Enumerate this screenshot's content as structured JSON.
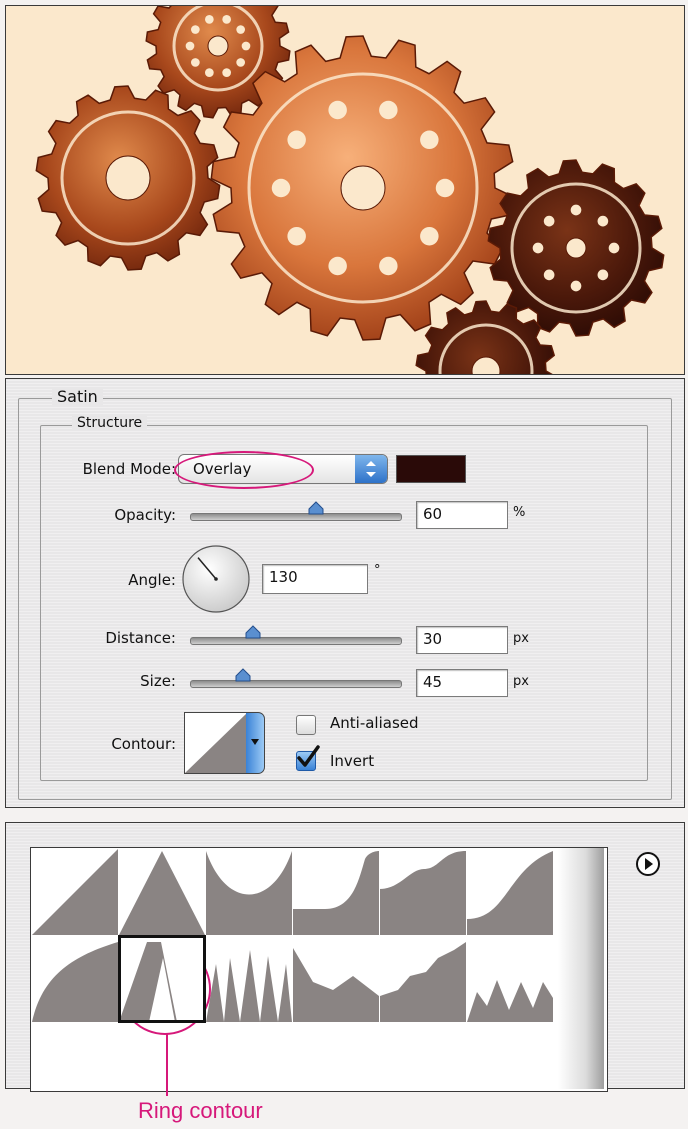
{
  "satin": {
    "title": "Satin",
    "structure_title": "Structure",
    "blend_mode": {
      "label": "Blend Mode:",
      "value": "Overlay",
      "swatch_color": "#2a0a08"
    },
    "opacity": {
      "label": "Opacity:",
      "value": "60",
      "unit": "%",
      "level": 0.6
    },
    "angle": {
      "label": "Angle:",
      "value": "130",
      "unit": "°"
    },
    "distance": {
      "label": "Distance:",
      "value": "30",
      "unit": "px",
      "level": 0.3
    },
    "size": {
      "label": "Size:",
      "value": "45",
      "unit": "px",
      "level": 0.25
    },
    "contour": {
      "label": "Contour:"
    },
    "anti_aliased": {
      "label": "Anti-aliased",
      "checked": false
    },
    "invert": {
      "label": "Invert",
      "checked": true
    }
  },
  "contour_picker": {
    "presets": [
      "linear",
      "cone",
      "cone-inverted",
      "gaussian",
      "half-round",
      "rolling-slope",
      "rounded-steps",
      "ring",
      "ring-double",
      "cove-deep",
      "cove-shallow",
      "sawtooth"
    ],
    "selected_index": 7
  },
  "annotation": {
    "caption": "Ring contour",
    "color": "#d6187a"
  },
  "colors": {
    "highlight": "#d6187a",
    "contour_fill": "#8a8483",
    "slider_thumb": "#5a8fd0"
  }
}
